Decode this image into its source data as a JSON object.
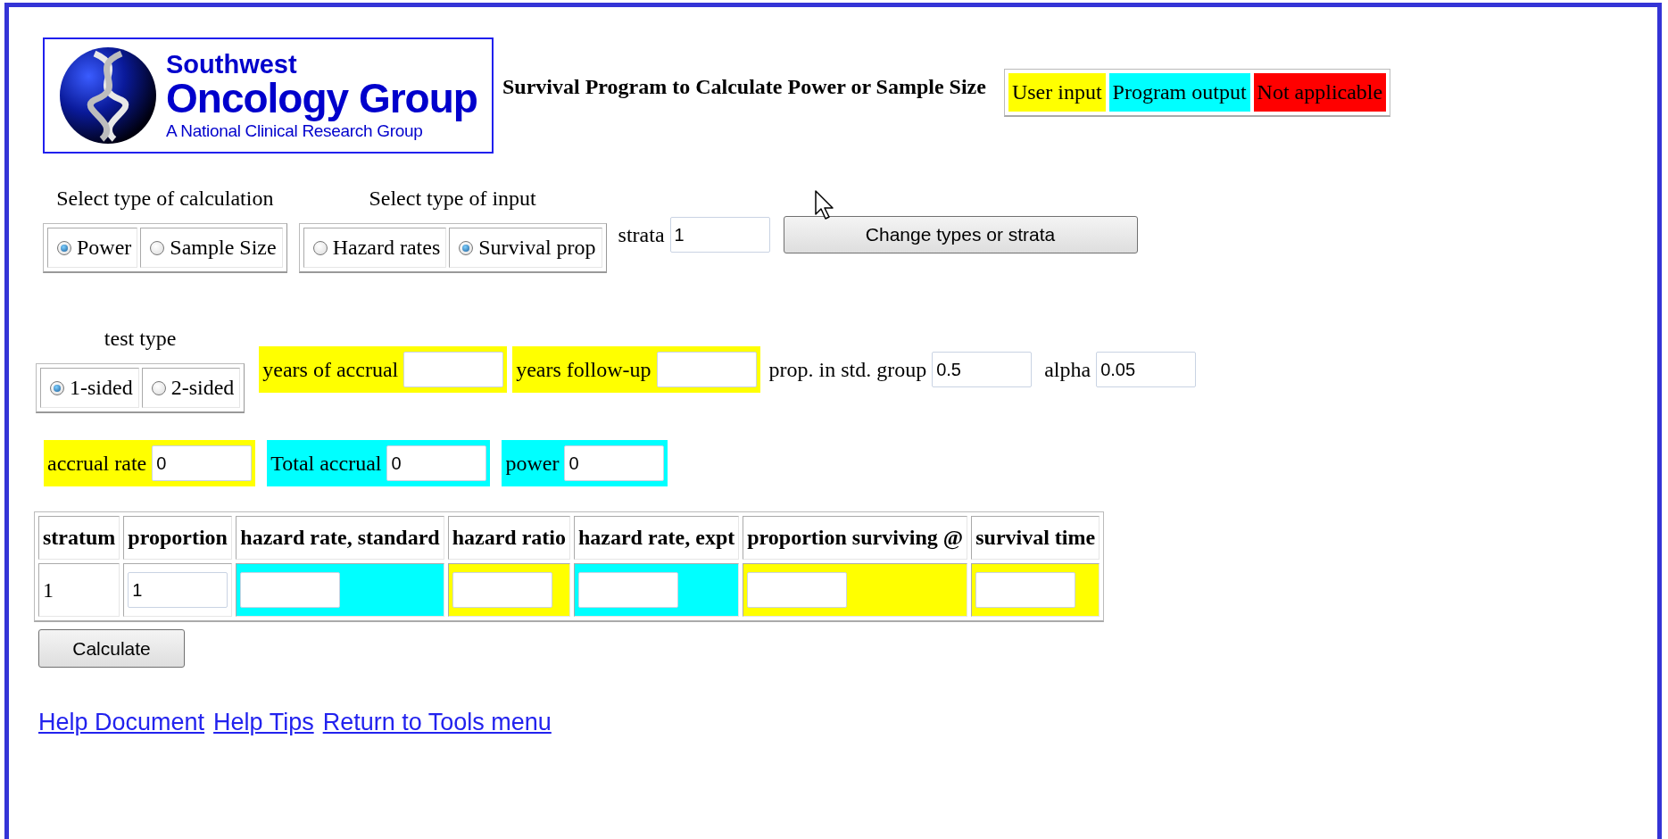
{
  "logo": {
    "line_1": "Southwest",
    "line_2": "Oncology Group",
    "line_3": "A National Clinical Research Group"
  },
  "title": "Survival Program to Calculate Power or Sample Size",
  "legend": [
    {
      "label": "User input",
      "color": "#ffff00"
    },
    {
      "label": "Program output",
      "color": "#00ffff"
    },
    {
      "label": "Not applicable",
      "color": "#ff0000"
    }
  ],
  "calculation_type": {
    "caption": "Select type of calculation",
    "options": [
      {
        "label": "Power",
        "selected": true
      },
      {
        "label": "Sample Size",
        "selected": false
      }
    ]
  },
  "input_type": {
    "caption": "Select type of input",
    "options": [
      {
        "label": "Hazard rates",
        "selected": false
      },
      {
        "label": "Survival prop",
        "selected": true
      }
    ]
  },
  "strata": {
    "label": "strata",
    "value": "1"
  },
  "change_button": "Change types or strata",
  "test_type": {
    "caption": "test type",
    "options": [
      {
        "label": "1-sided",
        "selected": true
      },
      {
        "label": "2-sided",
        "selected": false
      }
    ]
  },
  "fields_row_1": [
    {
      "label": "years of accrual",
      "color": "#ffff00"
    },
    {
      "label": "years follow-up",
      "color": "#ffff00"
    },
    {
      "label": "prop. in std. group",
      "value": "0.5"
    },
    {
      "label": "alpha",
      "value": "0.05"
    }
  ],
  "fields_row_2": [
    {
      "label": "accrual rate",
      "value": "0",
      "color": "#ffff00"
    },
    {
      "label": "Total accrual",
      "value": "0",
      "color": "#00ffff"
    },
    {
      "label": "power",
      "value": "0",
      "color": "#00ffff"
    }
  ],
  "table": {
    "columns": [
      "stratum",
      "proportion",
      "hazard rate, standard",
      "hazard ratio",
      "hazard rate, expt",
      "proportion surviving @",
      "survival time"
    ],
    "rows": [
      {
        "cells": [
          {
            "kind": "text",
            "text": "1"
          },
          {
            "kind": "input",
            "value": "1"
          },
          {
            "kind": "input",
            "color": "#00ffff"
          },
          {
            "kind": "input",
            "color": "#ffff00"
          },
          {
            "kind": "input",
            "color": "#00ffff"
          },
          {
            "kind": "input",
            "color": "#ffff00"
          },
          {
            "kind": "input",
            "color": "#ffff00"
          }
        ]
      }
    ]
  },
  "calculate_button": "Calculate",
  "links": [
    "Help Document",
    "Help Tips",
    "Return to Tools menu"
  ]
}
